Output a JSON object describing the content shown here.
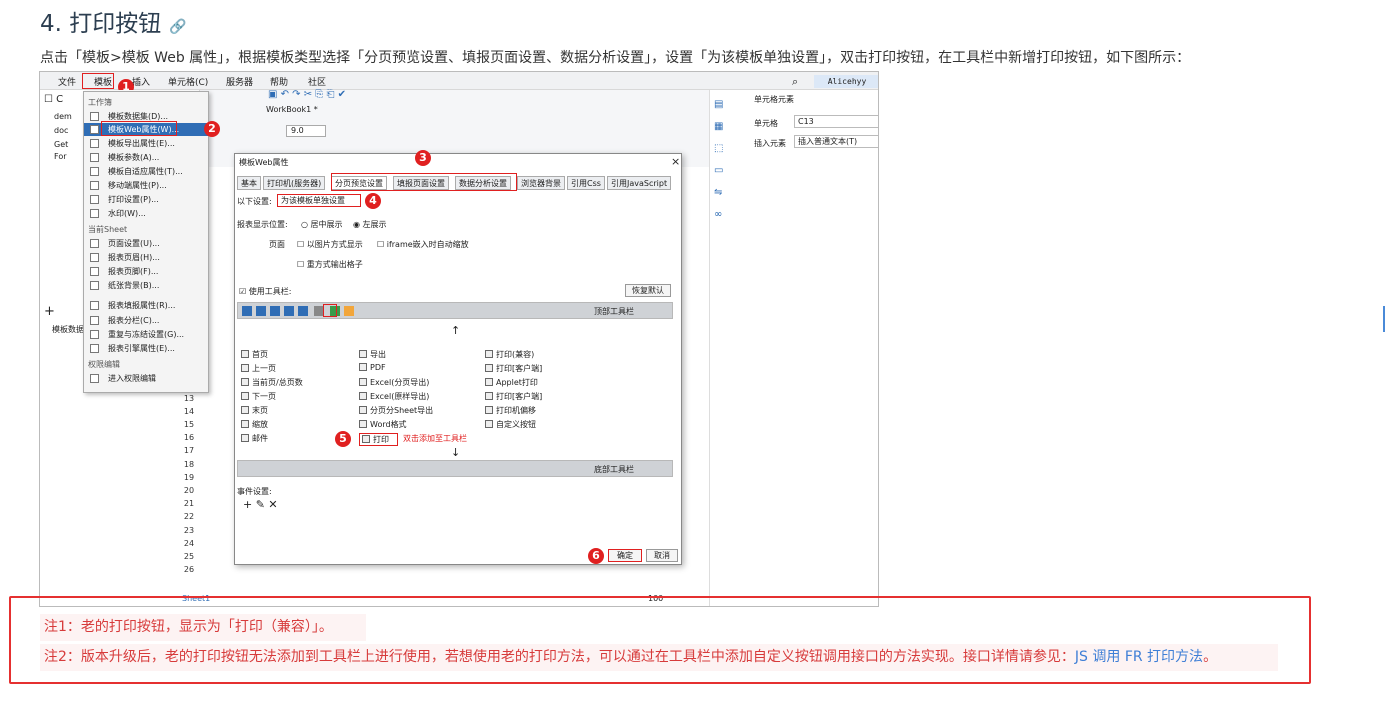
{
  "heading": {
    "title": "4. 打印按钮",
    "anchor_icon": "link-icon"
  },
  "intro": "点击「模板>模板 Web 属性」，根据模板类型选择「分页预览设置、填报页面设置、数据分析设置」，设置「为该模板单独设置」，双击打印按钮，在工具栏中新增打印按钮，如下图所示：",
  "screenshot": {
    "menubar": [
      "文件",
      "模板",
      "插入",
      "单元格(C)",
      "服务器",
      "帮助",
      "社区"
    ],
    "user": "Alicehyy",
    "template_menu": {
      "section_workbook": "工作簿",
      "items_top": [
        "模板数据集(D)...",
        "模板Web属性(W)...",
        "模板导出属性(E)...",
        "模板参数(A)...",
        "模板自适应属性(T)...",
        "移动端属性(P)...",
        "打印设置(P)...",
        "水印(W)..."
      ],
      "section_sheet": "当前Sheet",
      "items_sheet": [
        "页面设置(U)...",
        "报表页眉(H)...",
        "报表页脚(F)...",
        "纸张背景(B)..."
      ],
      "items_more": [
        "报表填报属性(R)...",
        "报表分栏(C)...",
        "重复与冻结设置(G)...",
        "报表引擎属性(E)..."
      ],
      "section_perm": "权限编辑",
      "items_perm": [
        "进入权限编辑"
      ]
    },
    "tree": [
      "dem",
      "doc",
      "Get",
      "For"
    ],
    "workbook_tab": "WorkBook1 *",
    "font_size": "9.0",
    "left_bottom_label": "模板数据",
    "row_numbers": [
      "13",
      "14",
      "15",
      "16",
      "17",
      "18",
      "19",
      "20",
      "21",
      "22",
      "23",
      "24",
      "25",
      "26"
    ],
    "right_panel": {
      "title": "单元格元素",
      "cell_label": "单元格",
      "cell_value": "C13",
      "insert_label": "插入元素",
      "insert_value": "插入普通文本(T)"
    },
    "dialog": {
      "title": "模板Web属性",
      "close": "×",
      "tabs": [
        "基本",
        "打印机(服务器)",
        "分页预览设置",
        "填报页面设置",
        "数据分析设置",
        "浏览器背景",
        "引用Css",
        "引用JavaScript"
      ],
      "setting_label": "以下设置:",
      "setting_value": "为该模板单独设置",
      "position_label": "报表显示位置:",
      "position_center": "居中展示",
      "position_left": "左展示",
      "page_label": "页面",
      "opt_image": "以图片方式显示",
      "opt_iframe": "iframe嵌入时自动缩放",
      "opt_repeat": "重方式输出格子",
      "use_toolbar": "使用工具栏:",
      "reset": "恢复默认",
      "top_toolbar": "顶部工具栏",
      "bottom_toolbar": "底部工具栏",
      "arrow_up": "↑",
      "arrow_down": "↓",
      "col1": [
        "首页",
        "上一页",
        "当前页/总页数",
        "下一页",
        "末页",
        "缩放",
        "邮件"
      ],
      "col2": [
        "导出",
        "PDF",
        "Excel(分页导出)",
        "Excel(原样导出)",
        "分页分Sheet导出",
        "Word格式",
        "打印"
      ],
      "col3": [
        "打印(兼容)",
        "打印[客户端]",
        "Applet打印",
        "打印[客户端]",
        "打印机偏移",
        "自定义按钮"
      ],
      "dbl_click_note": "双击添加至工具栏",
      "event_label": "事件设置:",
      "ok": "确定",
      "cancel": "取消"
    },
    "sheet_tab": "Sheet1",
    "zoom": "100",
    "badges": [
      "1",
      "2",
      "3",
      "4",
      "5",
      "6"
    ]
  },
  "notes": {
    "note1": "注1：老的打印按钮，显示为「打印（兼容）」。",
    "note2_text": "注2：版本升级后，老的打印按钮无法添加到工具栏上进行使用，若想使用老的打印方法，可以通过在工具栏中添加自定义按钮调用接口的方法实现。接口详情请参见：",
    "note2_link": "JS 调用 FR 打印方法",
    "note2_end": "。"
  },
  "colors": {
    "accent_red": "#e02020",
    "link_blue": "#3f7fd6",
    "note_red": "#d73b3b"
  }
}
